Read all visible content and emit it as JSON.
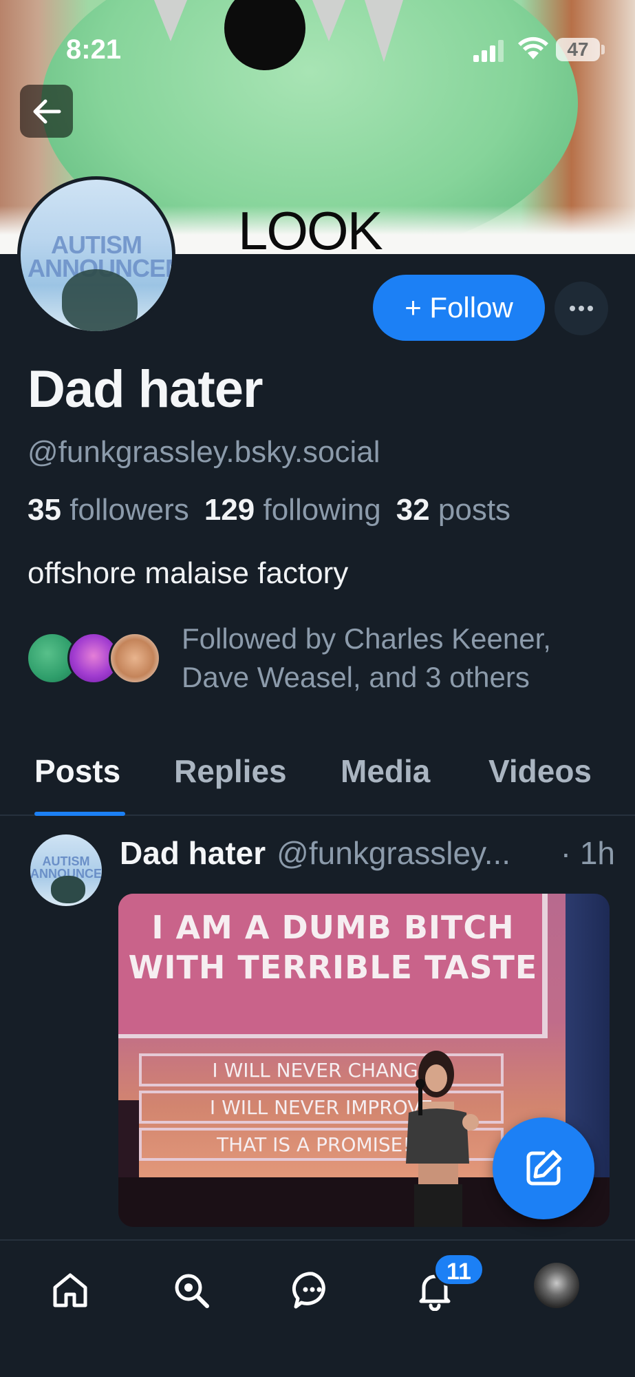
{
  "status_bar": {
    "time": "8:21",
    "battery": "47"
  },
  "banner": {
    "text": "LOOK"
  },
  "avatar": {
    "text": "AUTISM ANNOUNCEMENT"
  },
  "profile": {
    "display_name": "Dad hater",
    "handle": "@funkgrassley.bsky.social",
    "followers_count": "35",
    "followers_label": "followers",
    "following_count": "129",
    "following_label": "following",
    "posts_count": "32",
    "posts_label": "posts",
    "bio": "offshore malaise factory",
    "followed_by": "Followed by Charles Keener, Dave Weasel, and 3 others"
  },
  "actions": {
    "follow_label": "+ Follow",
    "more_icon": "ellipsis-icon"
  },
  "tabs": [
    {
      "label": "Posts",
      "active": true
    },
    {
      "label": "Replies",
      "active": false
    },
    {
      "label": "Media",
      "active": false
    },
    {
      "label": "Videos",
      "active": false
    }
  ],
  "post": {
    "author": "Dad hater",
    "handle": "@funkgrassley...",
    "time": "· 1h",
    "image_text": {
      "headline": "I AM A DUMB BITCH WITH TERRIBLE TASTE",
      "line1": "I WILL NEVER CHANGE",
      "line2": "I WILL NEVER IMPROVE",
      "line3": "THAT IS A PROMISE!!!"
    }
  },
  "nav": {
    "items": [
      "home-icon",
      "search-icon",
      "chat-icon",
      "bell-icon",
      "profile-avatar"
    ],
    "notification_badge": "11"
  },
  "colors": {
    "background": "#161e27",
    "accent": "#1c80f5",
    "muted_text": "#8c9bab"
  }
}
